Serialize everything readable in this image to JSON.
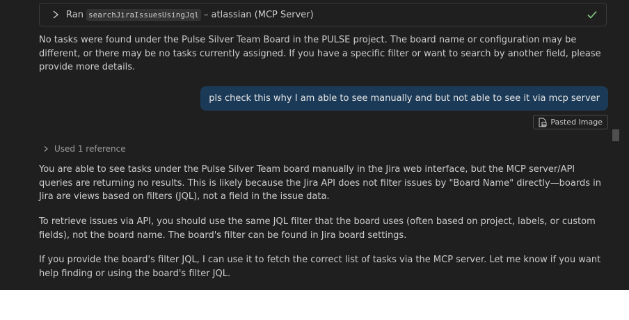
{
  "tool_call": {
    "ran_label": "Ran",
    "tool_name": "searchJiraIssuesUsingJql",
    "source": "– atlassian (MCP Server)",
    "chevron_icon": "chevron-right-icon",
    "status_icon": "check-icon",
    "status_color": "#89d185"
  },
  "response_1": "No tasks were found under the Pulse Silver Team Board in the PULSE project. The board name or configuration may be different, or there may be no tasks currently assigned. If you have a specific filter or want to search by another field, please provide more details.",
  "user_message": {
    "text": "pls check this why I am able to see manually and but not able to see it via mcp server",
    "bubble_color": "#1b3a57",
    "attachment_label": "Pasted Image",
    "attachment_icon": "image-file-icon"
  },
  "references": {
    "label": "Used 1 reference",
    "chevron_icon": "chevron-right-icon"
  },
  "response_2": [
    "You are able to see tasks under the Pulse Silver Team board manually in the Jira web interface, but the MCP server/API queries are returning no results. This is likely because the Jira API does not filter issues by \"Board Name\" directly—boards in Jira are views based on filters (JQL), not a field in the issue data.",
    "To retrieve issues via API, you should use the same JQL filter that the board uses (often based on project, labels, or custom fields), not the board name. The board's filter can be found in Jira board settings.",
    "If you provide the board's filter JQL, I can use it to fetch the correct list of tasks via the MCP server. Let me know if you want help finding or using the board's filter JQL."
  ]
}
